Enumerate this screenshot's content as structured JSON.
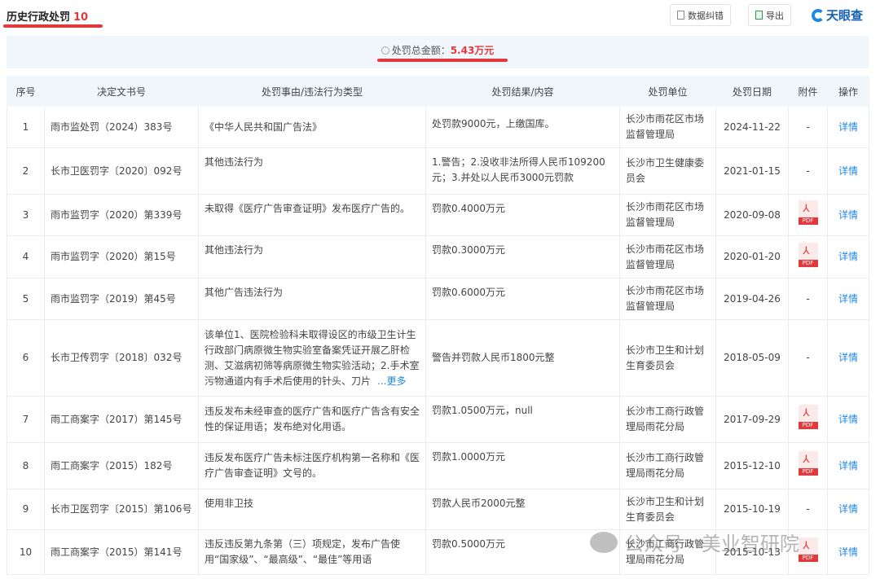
{
  "header": {
    "title": "历史行政处罚",
    "count": "10",
    "correct_label": "数据纠错",
    "export_label": "导出",
    "logo_text": "天眼查"
  },
  "summary": {
    "label": "处罚总金额：",
    "amount": "5.43万元"
  },
  "columns": [
    "序号",
    "决定文书号",
    "处罚事由/违法行为类型",
    "处罚结果/内容",
    "处罚单位",
    "处罚日期",
    "附件",
    "操作"
  ],
  "rows": [
    {
      "no": "1",
      "doc": "雨市监处罚（2024）383号",
      "reason": "《中华人民共和国广告法》",
      "result": "处罚款9000元，上缴国库。",
      "unit": "长沙市雨花区市场监督管理局",
      "date": "2024-11-22",
      "attach": "-",
      "action": "详情"
    },
    {
      "no": "2",
      "doc": "长市卫医罚字〔2020〕092号",
      "reason": "其他违法行为",
      "result": "1.警告；2.没收非法所得人民币109200元；3.并处以人民币3000元罚款",
      "unit": "长沙市卫生健康委员会",
      "date": "2021-01-15",
      "attach": "-",
      "action": "详情"
    },
    {
      "no": "3",
      "doc": "雨市监罚字（2020）第339号",
      "reason": "未取得《医疗广告审查证明》发布医疗广告的。",
      "result": "罚款0.4000万元",
      "unit": "长沙市雨花区市场监督管理局",
      "date": "2020-09-08",
      "attach": "PDF",
      "action": "详情"
    },
    {
      "no": "4",
      "doc": "雨市监罚字（2020）第15号",
      "reason": "其他违法行为",
      "result": "罚款0.3000万元",
      "unit": "长沙市雨花区市场监督管理局",
      "date": "2020-01-20",
      "attach": "PDF",
      "action": "详情"
    },
    {
      "no": "5",
      "doc": "雨市监罚字（2019）第45号",
      "reason": "其他广告违法行为",
      "result": "罚款0.6000万元",
      "unit": "长沙市雨花区市场监督管理局",
      "date": "2019-04-26",
      "attach": "-",
      "action": "详情"
    },
    {
      "no": "6",
      "doc": "长市卫传罚字〔2018〕032号",
      "reason": "该单位1、医院检验科未取得设区的市级卫生计生行政部门病原微生物实验室备案凭证开展乙肝检测、艾滋病初筛等病原微生物实验活动；2.手术室污物通道内有手术后使用的针头、刀片",
      "more": "...更多",
      "result": "警告并罚款人民币1800元整",
      "unit": "长沙市卫生和计划生育委员会",
      "date": "2018-05-09",
      "attach": "-",
      "action": "详情"
    },
    {
      "no": "7",
      "doc": "雨工商案字（2017）第145号",
      "reason": "违反发布未经审查的医疗广告和医疗广告含有安全性的保证用语；发布绝对化用语。",
      "result": "罚款1.0500万元，null",
      "unit": "长沙市工商行政管理局雨花分局",
      "date": "2017-09-29",
      "attach": "PDF",
      "action": "详情"
    },
    {
      "no": "8",
      "doc": "雨工商案字（2015）182号",
      "reason": "违反发布医疗广告未标注医疗机构第一名称和《医疗广告审查证明》文号的。",
      "result": "罚款1.0000万元",
      "unit": "长沙市工商行政管理局雨花分局",
      "date": "2015-12-10",
      "attach": "PDF",
      "action": "详情"
    },
    {
      "no": "9",
      "doc": "长市卫医罚字〔2015〕第106号",
      "reason": "使用非卫技",
      "result": "罚款人民币2000元整",
      "unit": "长沙市卫生和计划生育委员会",
      "date": "2015-10-19",
      "attach": "-",
      "action": "详情"
    },
    {
      "no": "10",
      "doc": "雨工商案字（2015）第141号",
      "reason": "违反违反第九条第（三）项规定，发布广告使用“国家级”、“最高级”、“最佳”等用语",
      "result": "罚款0.5000万元",
      "unit": "长沙市工商行政管理局雨花分局",
      "date": "2015-10-13",
      "attach": "PDF",
      "action": "详情"
    }
  ],
  "watermark": "公众号 · 美业智研院",
  "colors": {
    "accent": "#e4393c",
    "link": "#1e88e5",
    "header_bg": "#f1f6fb"
  }
}
